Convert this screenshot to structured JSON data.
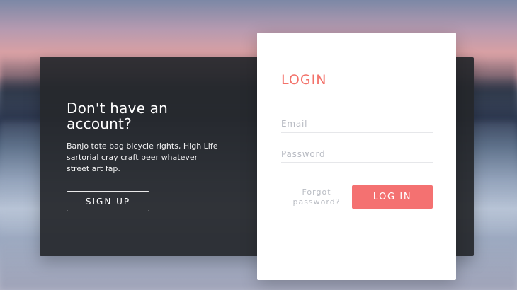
{
  "signup_panel": {
    "title": "Don't have an\naccount?",
    "description": "Banjo tote bag bicycle rights, High Life sartorial cray craft beer whatever street art fap.",
    "button_label": "Sign up"
  },
  "login_panel": {
    "title": "LOGIN",
    "email_placeholder": "Email",
    "password_placeholder": "Password",
    "forgot_label": "Forgot\npassword?",
    "submit_label": "Log in"
  }
}
